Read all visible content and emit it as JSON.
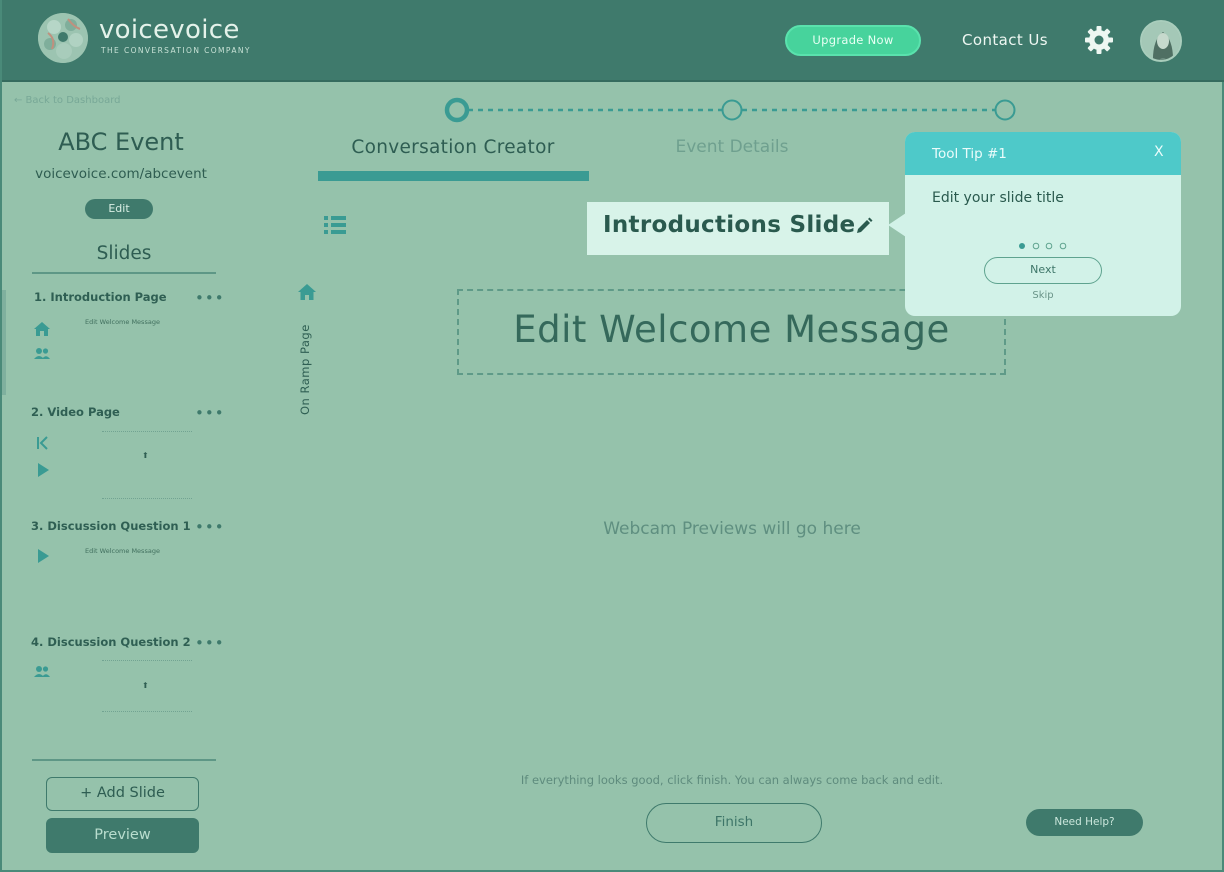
{
  "header": {
    "logo_name": "voicevoice",
    "logo_tagline": "THE CONVERSATION COMPANY",
    "upgrade_label": "Upgrade Now",
    "contact_label": "Contact Us",
    "settings_icon": "gear-icon",
    "avatar_icon": "user-avatar"
  },
  "sidebar": {
    "back_label": "← Back to Dashboard",
    "event_title": "ABC Event",
    "event_url": "voicevoice.com/abcevent",
    "edit_label": "Edit",
    "slides_heading": "Slides",
    "slides": [
      {
        "name": "1. Introduction Page",
        "preview_text": "Edit Welcome Message",
        "icons": [
          "home-icon",
          "people-icon"
        ]
      },
      {
        "name": "2. Video Page",
        "icons": [
          "skip-back-icon",
          "play-icon"
        ]
      },
      {
        "name": "3. Discussion Question 1",
        "preview_text": "Edit Welcome Message",
        "icons": [
          "play-icon"
        ]
      },
      {
        "name": "4. Discussion Question 2",
        "icons": [
          "people-icon"
        ]
      }
    ],
    "more_glyph": "•••",
    "add_slide_label": "+ Add Slide",
    "preview_label": "Preview"
  },
  "stepper": {
    "steps": 3,
    "active_step": 1
  },
  "tabs": {
    "creator_label": "Conversation Creator",
    "details_label": "Event Details"
  },
  "editor": {
    "slide_title": "Introductions Slide",
    "side_label": "On Ramp Page",
    "welcome_message": "Edit Welcome Message",
    "webcam_placeholder": "Webcam Previews will go here",
    "finish_hint": "If everything looks good, click finish. You can always come back and edit.",
    "finish_label": "Finish",
    "help_label": "Need Help?"
  },
  "tooltip": {
    "title": "Tool Tip #1",
    "close_label": "X",
    "body": "Edit your slide title",
    "page_count": 4,
    "current_page": 1,
    "next_label": "Next",
    "skip_label": "Skip"
  },
  "colors": {
    "header_bg": "#3f7a6c",
    "page_bg": "#95c2ab",
    "accent_green": "#47d39c",
    "tooltip_head": "#4ec9c9",
    "tab_underline": "#3a9b93"
  }
}
